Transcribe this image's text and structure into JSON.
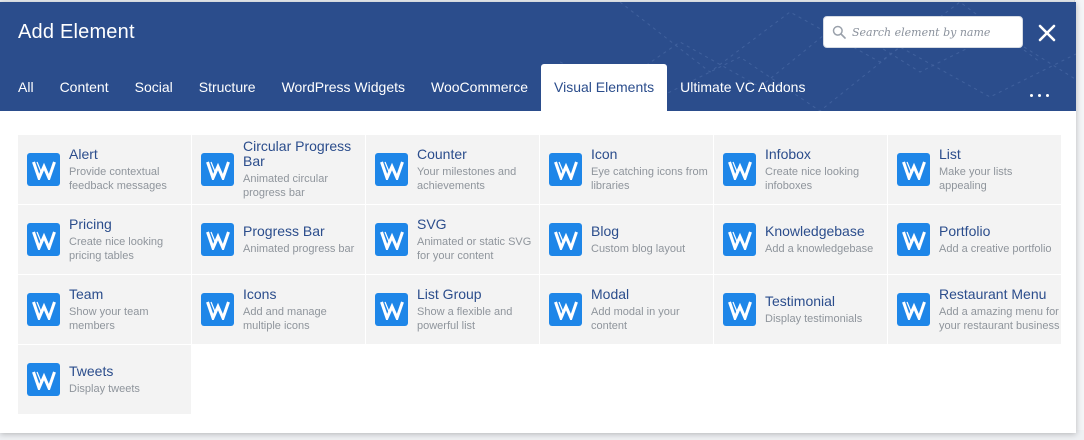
{
  "dialog": {
    "title": "Add Element",
    "search_placeholder": "Search element by name",
    "close_icon": "close-icon",
    "more_icon": "more-horizontal-icon"
  },
  "tabs": [
    {
      "label": "All",
      "active": false
    },
    {
      "label": "Content",
      "active": false
    },
    {
      "label": "Social",
      "active": false
    },
    {
      "label": "Structure",
      "active": false
    },
    {
      "label": "WordPress Widgets",
      "active": false
    },
    {
      "label": "WooCommerce",
      "active": false
    },
    {
      "label": "Visual Elements",
      "active": true
    },
    {
      "label": "Ultimate VC Addons",
      "active": false
    }
  ],
  "elements": [
    {
      "name": "Alert",
      "desc": "Provide contextual feedback messages"
    },
    {
      "name": "Circular Progress Bar",
      "desc": "Animated circular progress bar"
    },
    {
      "name": "Counter",
      "desc": "Your milestones and achievements"
    },
    {
      "name": "Icon",
      "desc": "Eye catching icons from libraries"
    },
    {
      "name": "Infobox",
      "desc": "Create nice looking infoboxes"
    },
    {
      "name": "List",
      "desc": "Make your lists appealing"
    },
    {
      "name": "Pricing",
      "desc": "Create nice looking pricing tables"
    },
    {
      "name": "Progress Bar",
      "desc": "Animated progress bar"
    },
    {
      "name": "SVG",
      "desc": "Animated or static SVG for your content"
    },
    {
      "name": "Blog",
      "desc": "Custom blog layout"
    },
    {
      "name": "Knowledgebase",
      "desc": "Add a knowledgebase"
    },
    {
      "name": "Portfolio",
      "desc": "Add a creative portfolio"
    },
    {
      "name": "Team",
      "desc": "Show your team members"
    },
    {
      "name": "Icons",
      "desc": "Add and manage multiple icons"
    },
    {
      "name": "List Group",
      "desc": "Show a flexible and powerful list"
    },
    {
      "name": "Modal",
      "desc": "Add modal in your content"
    },
    {
      "name": "Testimonial",
      "desc": "Display testimonials"
    },
    {
      "name": "Restaurant Menu",
      "desc": "Add a amazing menu for your restaurant business"
    },
    {
      "name": "Tweets",
      "desc": "Display tweets"
    }
  ],
  "colors": {
    "header": "#2b4d8c",
    "accent": "#1e86e8",
    "cell_bg": "#f3f3f3",
    "title_text": "#2b4d8c",
    "desc_text": "#8f959c"
  },
  "element_icon": "w-logo-icon"
}
